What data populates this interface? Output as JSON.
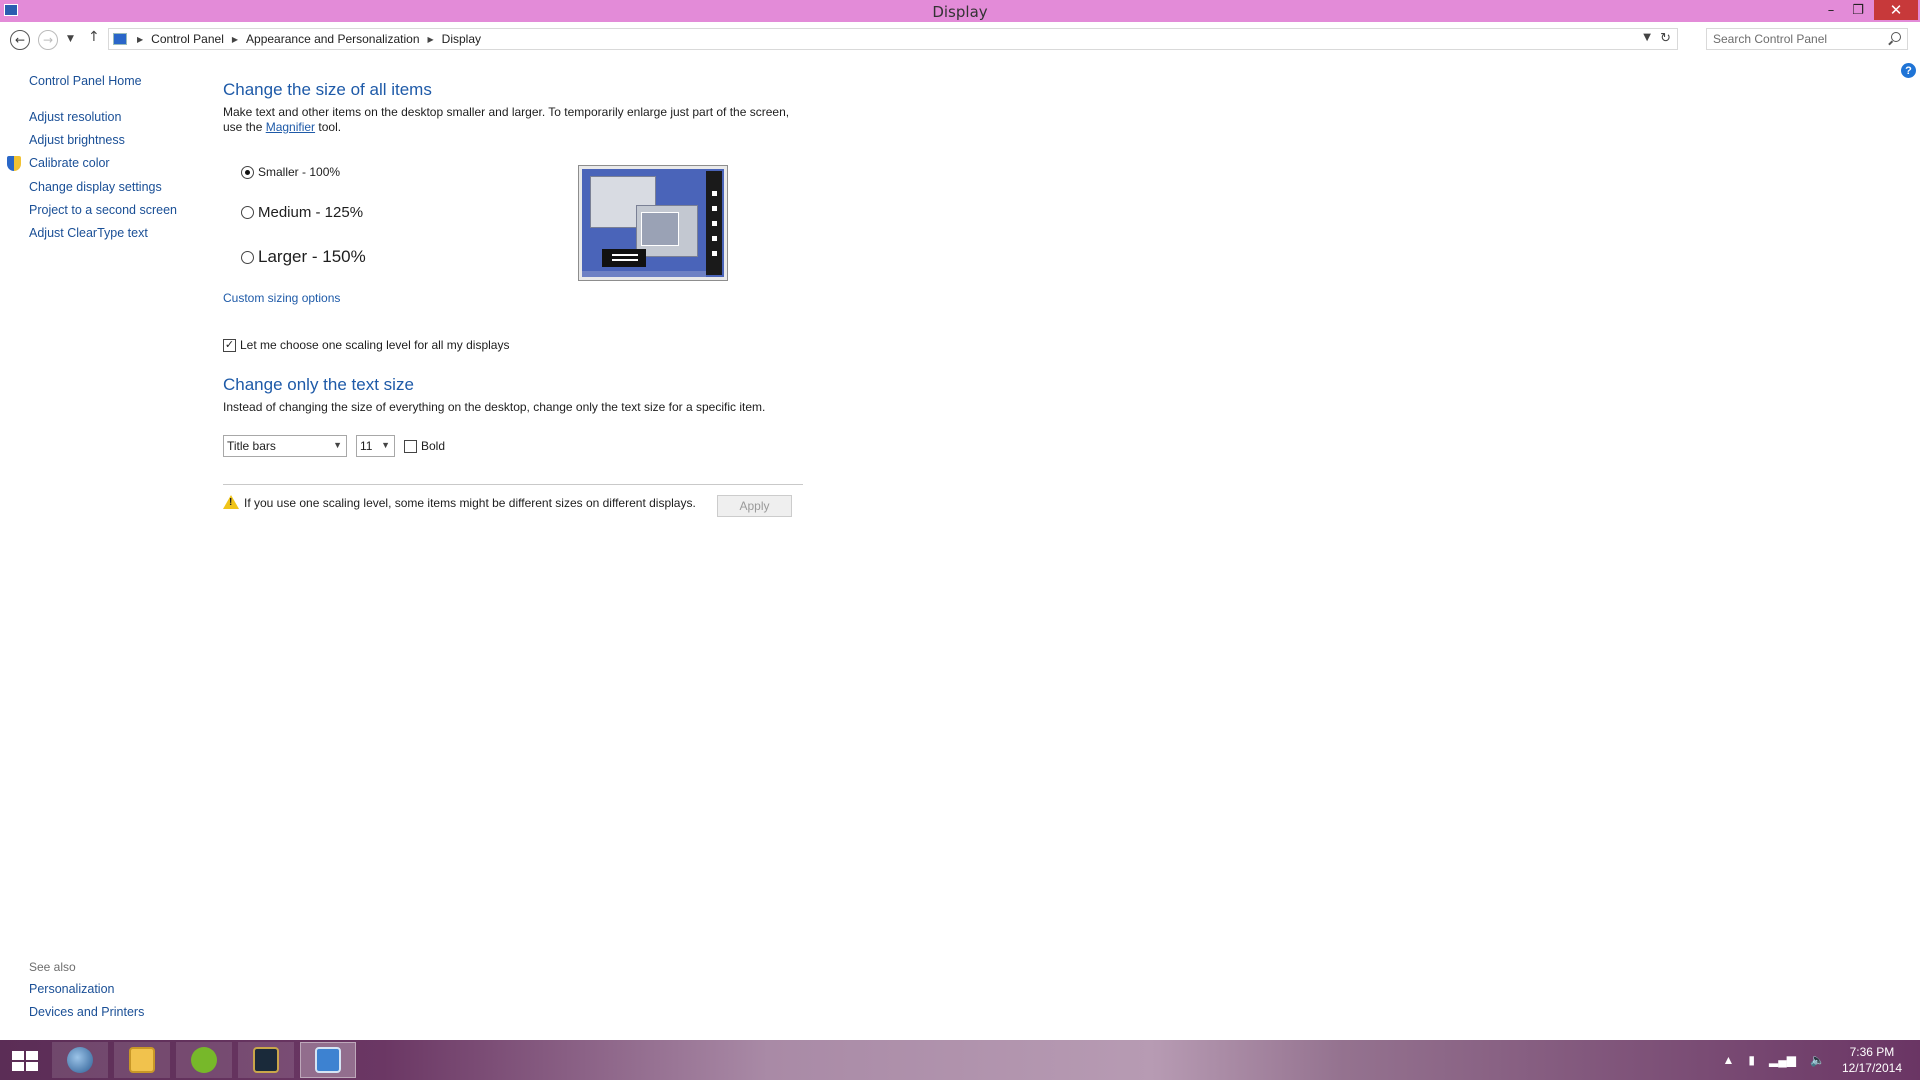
{
  "window": {
    "title": "Display",
    "minimize_glyph": "–",
    "restore_glyph": "❐",
    "close_glyph": "✕"
  },
  "address": {
    "breadcrumbs": [
      "Control Panel",
      "Appearance and Personalization",
      "Display"
    ],
    "search_placeholder": "Search Control Panel"
  },
  "sidebar": {
    "home": "Control Panel Home",
    "items": [
      "Adjust resolution",
      "Adjust brightness",
      "Calibrate color",
      "Change display settings",
      "Project to a second screen",
      "Adjust ClearType text"
    ],
    "see_also_label": "See also",
    "see_also": [
      "Personalization",
      "Devices and Printers"
    ]
  },
  "main": {
    "section1_title": "Change the size of all items",
    "section1_desc_pre": "Make text and other items on the desktop smaller and larger. To temporarily enlarge just part of the screen, use the ",
    "section1_link": "Magnifier",
    "section1_desc_post": " tool.",
    "options": [
      {
        "label": "Smaller - 100%",
        "checked": true
      },
      {
        "label": "Medium - 125%",
        "checked": false
      },
      {
        "label": "Larger - 150%",
        "checked": false
      }
    ],
    "custom_sizing": "Custom sizing options",
    "scaling_checkbox": "Let me choose one scaling level for all my displays",
    "scaling_checked": true,
    "section2_title": "Change only the text size",
    "section2_desc": "Instead of changing the size of everything on the desktop, change only the text size for a specific item.",
    "item_select": "Title bars",
    "size_select": "11",
    "bold_label": "Bold",
    "bold_checked": false,
    "warning": "If you use one scaling level, some items might be different sizes on different displays.",
    "apply": "Apply"
  },
  "taskbar": {
    "apps": [
      "start-icon",
      "globe-icon",
      "file-explorer-icon",
      "utorrent-icon",
      "league-of-legends-icon",
      "control-panel-icon"
    ],
    "time": "7:36 PM",
    "date": "12/17/2014"
  },
  "colors": {
    "titlebar": "#e38bd8",
    "link": "#1a4f96",
    "heading": "#1e5aa8"
  }
}
